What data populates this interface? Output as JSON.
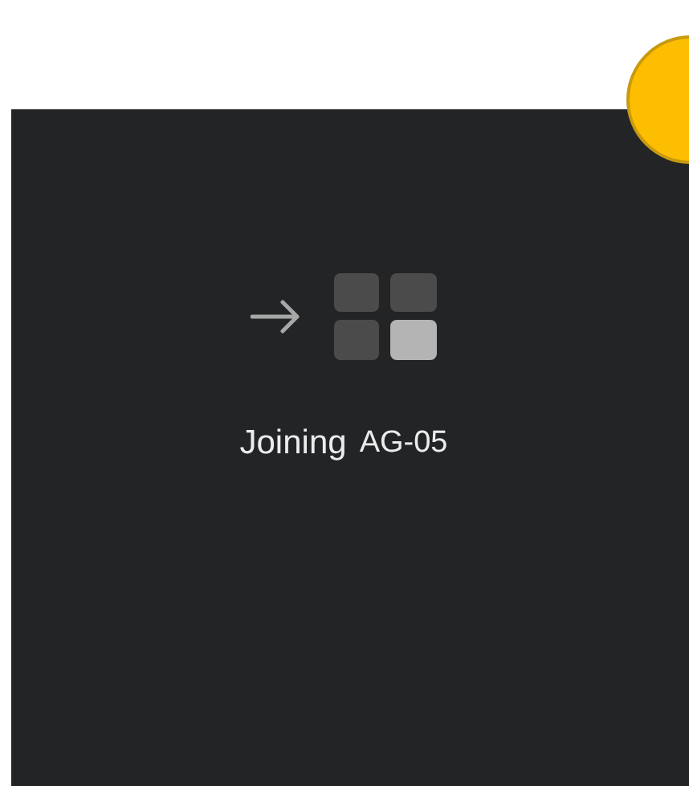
{
  "status": {
    "label": "Joining",
    "room": "AG-05"
  }
}
